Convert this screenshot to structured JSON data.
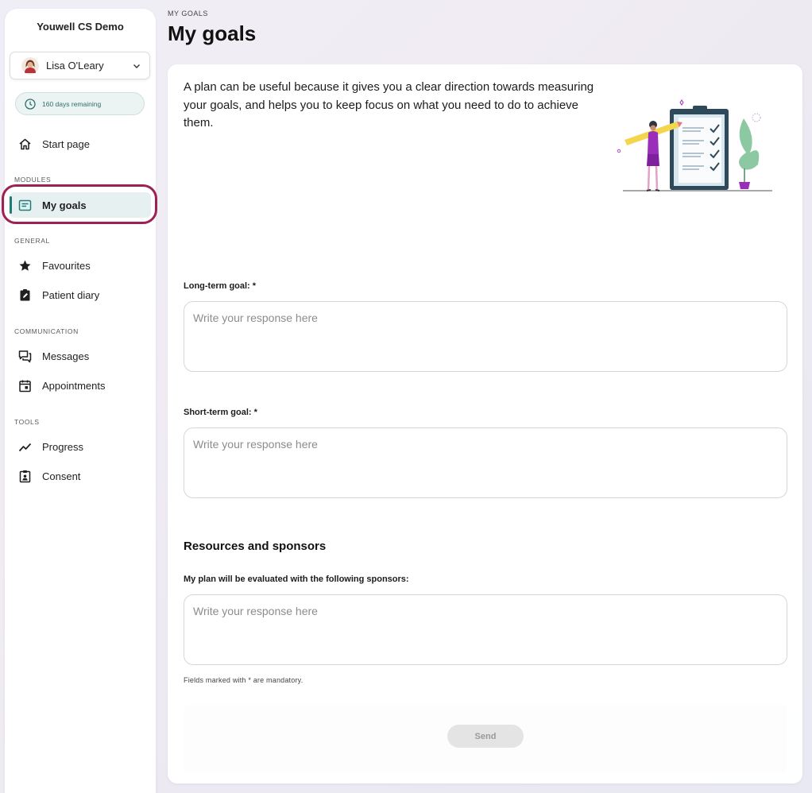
{
  "app": {
    "title": "Youwell CS Demo"
  },
  "user": {
    "name": "Lisa O'Leary",
    "avatar_icon": "user-avatar"
  },
  "subscription": {
    "days_remaining": "160 days remaining"
  },
  "sidebar": {
    "start_page": "Start page",
    "sections": {
      "modules": "MODULES",
      "general": "GENERAL",
      "communication": "COMMUNICATION",
      "tools": "TOOLS"
    },
    "items": {
      "my_goals": "My goals",
      "favourites": "Favourites",
      "patient_diary": "Patient diary",
      "messages": "Messages",
      "appointments": "Appointments",
      "progress": "Progress",
      "consent": "Consent"
    }
  },
  "header": {
    "breadcrumb": "MY GOALS",
    "title": "My goals"
  },
  "main": {
    "intro": "A plan can be useful because it gives you a clear direction towards measuring your goals, and helps you to keep focus on what you need to do to achieve them.",
    "long_term_label": "Long-term goal: *",
    "short_term_label": "Short-term goal: *",
    "resources_heading": "Resources and sponsors",
    "sponsors_label": "My plan will be evaluated with the following sponsors:",
    "placeholder": "Write your response here",
    "mandatory_note": "Fields marked with * are mandatory.",
    "send_label": "Send"
  },
  "colors": {
    "accent": "#1e7d78",
    "highlight_ring": "#9c2253",
    "active_bg": "#e7f0f0"
  }
}
